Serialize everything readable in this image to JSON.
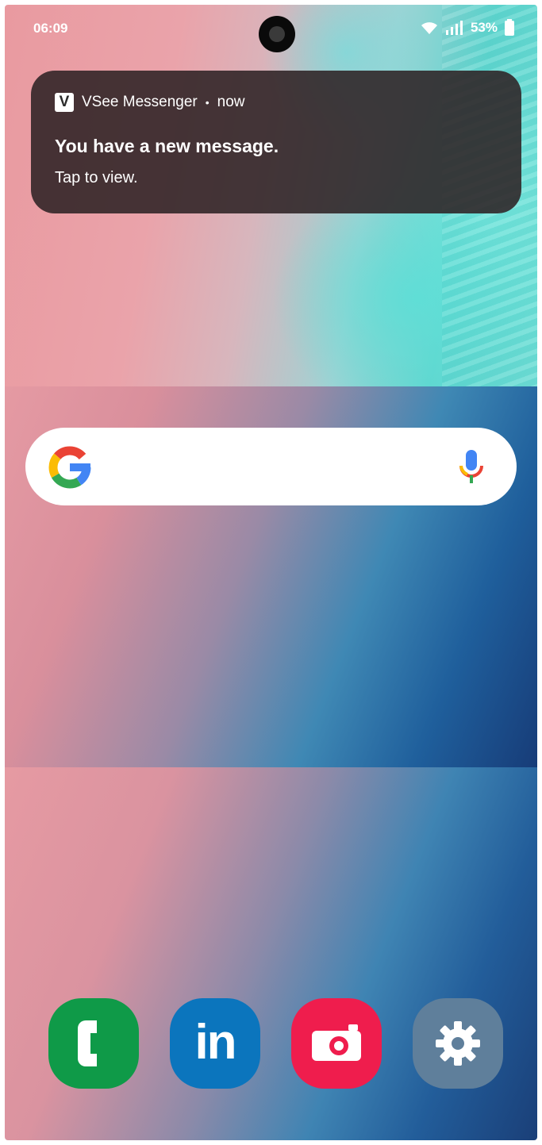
{
  "status_bar": {
    "time": "06:09",
    "battery_percent": "53%",
    "icons": [
      "wifi-icon",
      "signal-icon",
      "battery-icon"
    ]
  },
  "notification": {
    "app_icon_letter": "V",
    "app_name": "VSee Messenger",
    "separator": "•",
    "time": "now",
    "title": "You have a new message.",
    "body": "Tap to view."
  },
  "search_widget": {
    "icons": [
      "google-g-icon",
      "microphone-icon"
    ]
  },
  "dock": {
    "apps": [
      {
        "name": "Phone",
        "icon": "phone-icon",
        "color": "#0f9a48"
      },
      {
        "name": "LinkedIn",
        "icon": "linkedin-icon",
        "glyph": "in",
        "color": "#0b75bd"
      },
      {
        "name": "Camera",
        "icon": "camera-icon",
        "color": "#ef1d4d"
      },
      {
        "name": "Settings",
        "icon": "gear-icon",
        "color": "#5f7f9b"
      }
    ]
  }
}
